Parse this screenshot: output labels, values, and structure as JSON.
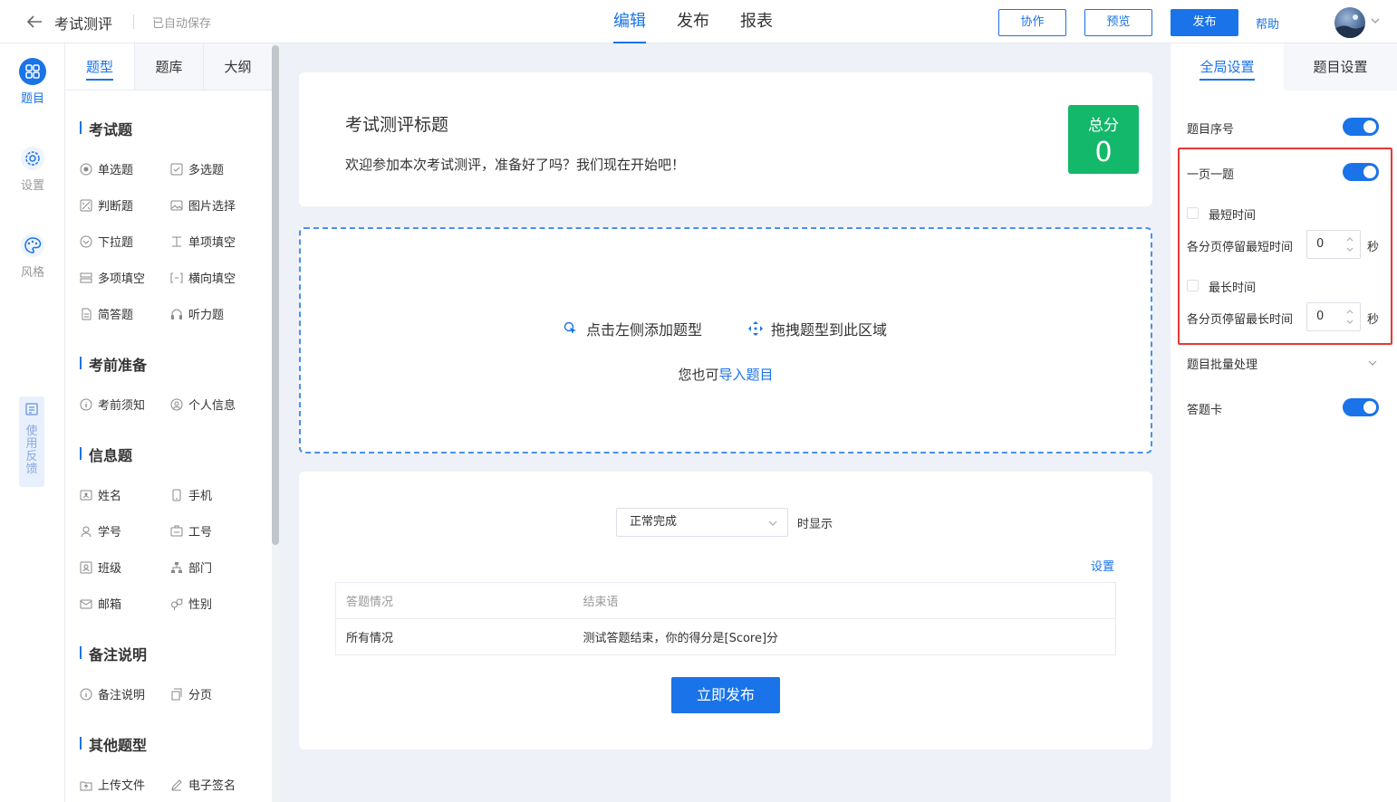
{
  "header": {
    "title": "考试测评",
    "autosave": "已自动保存",
    "tabs": [
      "编辑",
      "发布",
      "报表"
    ],
    "active_tab": "编辑",
    "collab": "协作",
    "preview": "预览",
    "publish": "发布",
    "help": "帮助"
  },
  "rail": {
    "questions": "题目",
    "settings": "设置",
    "style": "风格",
    "feedback": "使用反馈"
  },
  "qpanel": {
    "tabs": [
      "题型",
      "题库",
      "大纲"
    ],
    "sections": [
      {
        "title": "考试题",
        "items": [
          "单选题",
          "多选题",
          "判断题",
          "图片选择",
          "下拉题",
          "单项填空",
          "多项填空",
          "横向填空",
          "简答题",
          "听力题"
        ]
      },
      {
        "title": "考前准备",
        "items": [
          "考前须知",
          "个人信息"
        ]
      },
      {
        "title": "信息题",
        "items": [
          "姓名",
          "手机",
          "学号",
          "工号",
          "班级",
          "部门",
          "邮箱",
          "性别"
        ]
      },
      {
        "title": "备注说明",
        "items": [
          "备注说明",
          "分页"
        ]
      },
      {
        "title": "其他题型",
        "items": [
          "上传文件",
          "电子签名"
        ]
      }
    ]
  },
  "main": {
    "survey_title": "考试测评标题",
    "survey_desc": "欢迎参加本次考试测评，准备好了吗？我们现在开始吧！",
    "score_label": "总分",
    "score_value": "0",
    "dropzone": {
      "hint_add": "点击左侧添加题型",
      "hint_drag": "拖拽题型到此区域",
      "import_prefix": "您也可",
      "import_link": "导入题目"
    },
    "end": {
      "select_value": "正常完成",
      "select_suffix": "时显示",
      "settings_link": "设置",
      "table_headers": [
        "答题情况",
        "结束语"
      ],
      "table_rows": [
        [
          "所有情况",
          "测试答题结束，你的得分是[Score]分"
        ]
      ],
      "publish_now": "立即发布"
    }
  },
  "rpanel": {
    "tabs": [
      "全局设置",
      "题目设置"
    ],
    "question_number": "题目序号",
    "one_per_page": "一页一题",
    "min_time": "最短时间",
    "min_time_desc": "各分页停留最短时间",
    "min_time_value": "0",
    "max_time": "最长时间",
    "max_time_desc": "各分页停留最长时间",
    "max_time_value": "0",
    "unit": "秒",
    "batch": "题目批量处理",
    "answer_card": "答题卡"
  },
  "colors": {
    "accent": "#1a73e8",
    "score_bg": "#14b86a",
    "highlight_border": "#e53935"
  }
}
